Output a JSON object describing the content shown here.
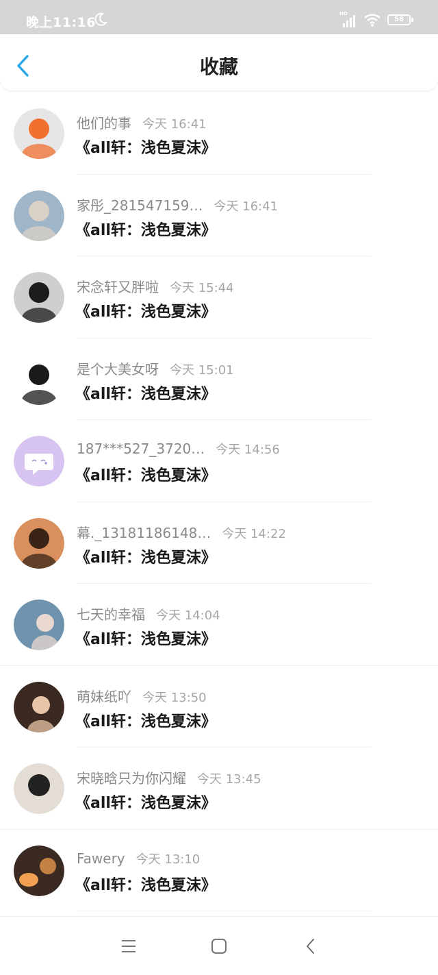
{
  "status_bar": {
    "time": "晚上11:16",
    "battery": "58",
    "hd_label": "HD"
  },
  "header": {
    "title": "收藏"
  },
  "items": [
    {
      "name": "他们的事",
      "time": "今天 16:41",
      "book": "《all轩：浅色夏沫》",
      "avatar_color": "#e6e6e6",
      "avatar_accent": "#f07030"
    },
    {
      "name": "家彤_281547159…",
      "time": "今天 16:41",
      "book": "《all轩：浅色夏沫》",
      "avatar_color": "#9fb6c8",
      "avatar_accent": "#d9d0c6"
    },
    {
      "name": "宋念轩又胖啦",
      "time": "今天 15:44",
      "book": "《all轩：浅色夏沫》",
      "avatar_color": "#cfcfcf",
      "avatar_accent": "#1c1c1c"
    },
    {
      "name": "是个大美女呀",
      "time": "今天 15:01",
      "book": "《all轩：浅色夏沫》",
      "avatar_color": "#ffffff",
      "avatar_accent": "#1a1a1a"
    },
    {
      "name": "187***527_3720…",
      "time": "今天 14:56",
      "book": "《all轩：浅色夏沫》",
      "avatar_color": "#d8c4f2",
      "avatar_accent": "#ffffff"
    },
    {
      "name": "幕._13181186148…",
      "time": "今天 14:22",
      "book": "《all轩：浅色夏沫》",
      "avatar_color": "#d98f5e",
      "avatar_accent": "#3a2418"
    },
    {
      "name": "七天的幸福",
      "time": "今天 14:04",
      "book": "《all轩：浅色夏沫》",
      "avatar_color": "#6f93ad",
      "avatar_accent": "#e9d8d0"
    },
    {
      "name": "萌妹纸吖",
      "time": "今天 13:50",
      "book": "《all轩：浅色夏沫》",
      "avatar_color": "#3a2a22",
      "avatar_accent": "#e8c5a6"
    },
    {
      "name": "宋晓晗只为你闪耀",
      "time": "今天 13:45",
      "book": "《all轩：浅色夏沫》",
      "avatar_color": "#e4ddd6",
      "avatar_accent": "#222222"
    },
    {
      "name": "Fawery",
      "time": "今天 13:10",
      "book": "《all轩：浅色夏沫》",
      "avatar_color": "#3b2a22",
      "avatar_accent": "#f0a050"
    }
  ],
  "nav": {
    "menu_icon": "menu-icon",
    "home_icon": "home-icon",
    "back_icon": "back-icon"
  },
  "colors": {
    "accent": "#2aa7e8",
    "name_gray": "#8a8a8a",
    "time_gray": "#a6a6a6"
  }
}
